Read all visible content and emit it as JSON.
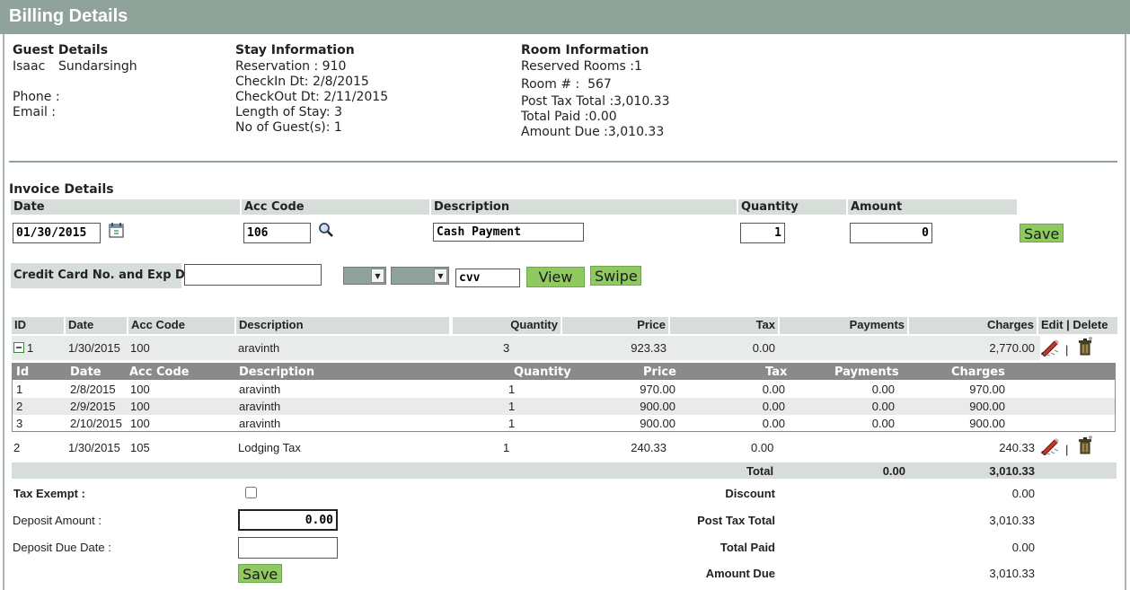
{
  "page": {
    "title": "Billing Details"
  },
  "guest": {
    "heading": "Guest Details",
    "first_name": "Isaac",
    "last_name": "Sundarsingh",
    "phone_label": "Phone :",
    "email_label": "Email :"
  },
  "stay": {
    "heading": "Stay Information",
    "reservation": "Reservation : 910",
    "checkin": "CheckIn Dt: 2/8/2015",
    "checkout": "CheckOut Dt: 2/11/2015",
    "length": "Length of Stay: 3",
    "guests": "No of Guest(s): 1"
  },
  "room": {
    "heading": "Room Information",
    "reserved": "Reserved Rooms :1",
    "room_no": "Room # :  567",
    "post_tax": "Post Tax Total :3,010.33",
    "total_paid": "Total Paid :0.00",
    "amount_due": "Amount Due :3,010.33"
  },
  "invoice": {
    "heading": "Invoice Details",
    "col_date": "Date",
    "col_acc": "Acc Code",
    "col_desc": "Description",
    "col_qty": "Quantity",
    "col_amount": "Amount",
    "date_value": "01/30/2015",
    "acc_value": "106",
    "desc_value": "Cash Payment",
    "qty_value": "1",
    "amount_value": "0",
    "save_label": "Save"
  },
  "card": {
    "label": "Credit Card No. and Exp Dt",
    "number_value": "",
    "cvv_value": "cvv",
    "view_label": "View",
    "swipe_label": "Swipe"
  },
  "table": {
    "headers": [
      "ID",
      "Date",
      "Acc Code",
      "Description",
      "Quantity",
      "Price",
      "Tax",
      "Payments",
      "Charges",
      "Edit | Delete"
    ],
    "rows": [
      {
        "id": "1",
        "date": "1/30/2015",
        "acc": "100",
        "desc": "aravinth",
        "qty": "3",
        "price": "923.33",
        "tax": "0.00",
        "payments": "",
        "charges": "2,770.00"
      },
      {
        "id": "2",
        "date": "1/30/2015",
        "acc": "105",
        "desc": "Lodging Tax",
        "qty": "1",
        "price": "240.33",
        "tax": "0.00",
        "payments": "",
        "charges": "240.33"
      }
    ],
    "edit_sep": "|",
    "sub_headers": [
      "Id",
      "Date",
      "Acc Code",
      "Description",
      "Quantity",
      "Price",
      "Tax",
      "Payments",
      "Charges"
    ],
    "sub_rows": [
      {
        "id": "1",
        "date": "2/8/2015",
        "acc": "100",
        "desc": "aravinth",
        "qty": "1",
        "price": "970.00",
        "tax": "0.00",
        "payments": "0.00",
        "charges": "970.00"
      },
      {
        "id": "2",
        "date": "2/9/2015",
        "acc": "100",
        "desc": "aravinth",
        "qty": "1",
        "price": "900.00",
        "tax": "0.00",
        "payments": "0.00",
        "charges": "900.00"
      },
      {
        "id": "3",
        "date": "2/10/2015",
        "acc": "100",
        "desc": "aravinth",
        "qty": "1",
        "price": "900.00",
        "tax": "0.00",
        "payments": "0.00",
        "charges": "900.00"
      }
    ],
    "total_label": "Total",
    "total_payments": "0.00",
    "total_charges": "3,010.33"
  },
  "summary": {
    "tax_exempt_label": "Tax Exempt :",
    "deposit_amount_label": "Deposit Amount :",
    "deposit_amount_value": "0.00",
    "deposit_due_label": "Deposit Due Date :",
    "deposit_due_value": "",
    "save_label": "Save",
    "discount_label": "Discount",
    "discount_value": "0.00",
    "post_tax_label": "Post Tax Total",
    "post_tax_value": "3,010.33",
    "total_paid_label": "Total Paid",
    "total_paid_value": "0.00",
    "amount_due_label": "Amount Due",
    "amount_due_value": "3,010.33"
  },
  "icons": {
    "calendar": "calendar-icon",
    "search": "search-icon",
    "edit": "edit-icon",
    "delete": "delete-icon",
    "collapse": "collapse-icon"
  }
}
